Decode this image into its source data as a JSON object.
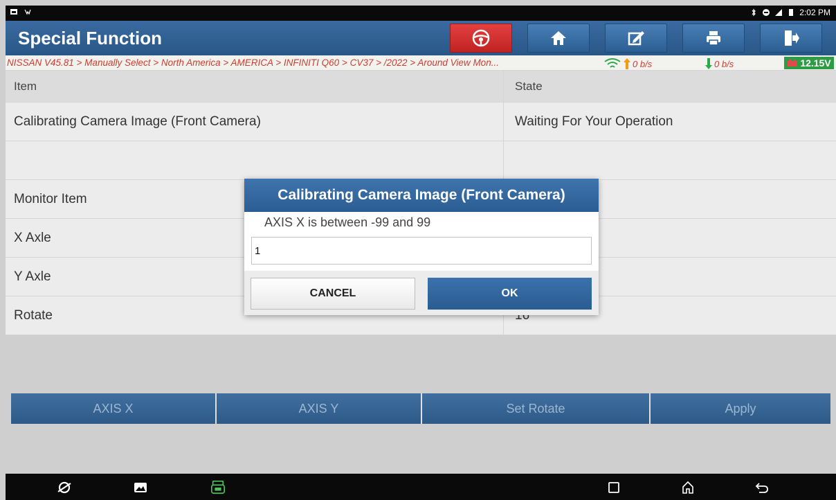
{
  "status_bar": {
    "time": "2:02 PM"
  },
  "header": {
    "title": "Special Function",
    "buttons": [
      "steering-wheel",
      "home",
      "edit-report",
      "print",
      "exit"
    ]
  },
  "breadcrumb": {
    "path": "NISSAN V45.81 > Manually Select > North America > AMERICA > INFINITI Q60 > CV37 > /2022 > Around View Mon...",
    "upload_speed": "0 b/s",
    "download_speed": "0 b/s",
    "voltage": "12.15V"
  },
  "table": {
    "col_item": "Item",
    "col_state": "State",
    "rows": [
      {
        "item": "Calibrating Camera Image (Front Camera)",
        "state": "Waiting For Your Operation"
      },
      {
        "item": "",
        "state": ""
      },
      {
        "item": "Monitor Item",
        "state": ""
      },
      {
        "item": "X Axle",
        "state": ""
      },
      {
        "item": "Y Axle",
        "state": ""
      },
      {
        "item": "Rotate",
        "state": "16"
      }
    ]
  },
  "actions": {
    "axis_x": "AXIS X",
    "axis_y": "AXIS Y",
    "set_rotate": "Set Rotate",
    "apply": "Apply"
  },
  "dialog": {
    "title": "Calibrating Camera Image (Front Camera)",
    "message": "AXIS X is between -99 and 99",
    "input_value": "1",
    "cancel_label": "CANCEL",
    "ok_label": "OK"
  },
  "colors": {
    "header_blue": "#2e5f92",
    "breadcrumb_red": "#d03c2f",
    "battery_green": "#2f9b45",
    "alert_red": "#d12f2f"
  }
}
